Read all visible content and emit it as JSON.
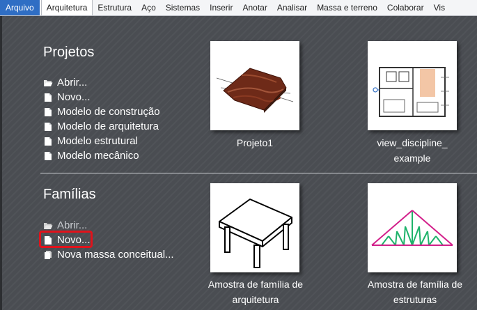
{
  "ribbon": {
    "tabs": [
      {
        "label": "Arquivo"
      },
      {
        "label": "Arquitetura"
      },
      {
        "label": "Estrutura"
      },
      {
        "label": "Aço"
      },
      {
        "label": "Sistemas"
      },
      {
        "label": "Inserir"
      },
      {
        "label": "Anotar"
      },
      {
        "label": "Analisar"
      },
      {
        "label": "Massa e terreno"
      },
      {
        "label": "Colaborar"
      },
      {
        "label": "Vis"
      }
    ],
    "active_tab": "Arquitetura"
  },
  "projects": {
    "title": "Projetos",
    "links": [
      {
        "label": "Abrir...",
        "icon": "folder-open-icon"
      },
      {
        "label": "Novo...",
        "icon": "document-icon"
      },
      {
        "label": "Modelo de construção",
        "icon": "document-icon"
      },
      {
        "label": "Modelo de arquitetura",
        "icon": "document-icon"
      },
      {
        "label": "Modelo estrutural",
        "icon": "document-icon"
      },
      {
        "label": "Modelo mecânico",
        "icon": "document-icon"
      }
    ],
    "recent": [
      {
        "caption": "Projeto1",
        "icon": "terrain-thumbnail"
      },
      {
        "caption_line1": "view_discipline_",
        "caption_line2": "example",
        "icon": "floor-plan-thumbnail"
      }
    ]
  },
  "families": {
    "title": "Famílias",
    "links": [
      {
        "label": "Abrir...",
        "icon": "folder-open-icon"
      },
      {
        "label": "Novo...",
        "icon": "document-icon"
      },
      {
        "label": "Nova massa conceitual...",
        "icon": "document-stack-icon"
      }
    ],
    "recent": [
      {
        "caption_line1": "Amostra de família de",
        "caption_line2": "arquitetura",
        "icon": "table-thumbnail"
      },
      {
        "caption_line1": "Amostra de família de",
        "caption_line2": "estruturas",
        "icon": "truss-thumbnail"
      }
    ]
  },
  "colors": {
    "file_tab": "#2f6ec4",
    "highlight": "#e0121b",
    "background": "#4a4d52"
  }
}
